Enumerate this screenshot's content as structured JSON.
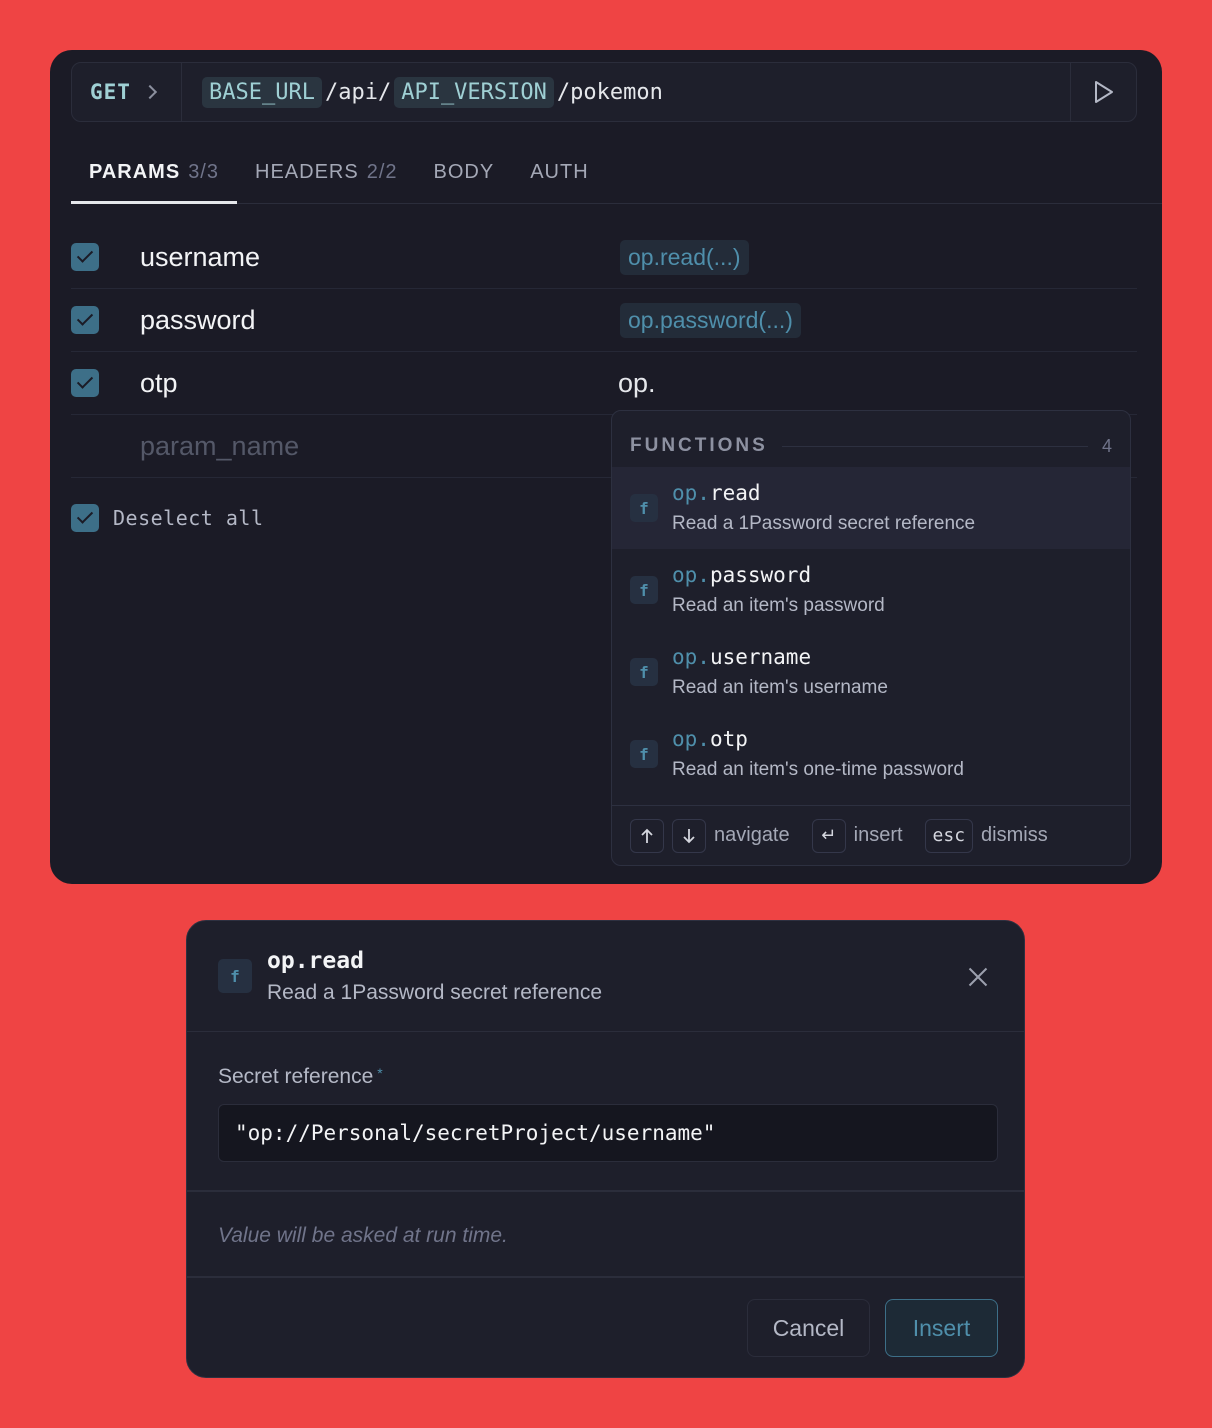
{
  "request": {
    "method": "GET",
    "url": {
      "base_var": "BASE_URL",
      "seg1": "/api/",
      "version_var": "API_VERSION",
      "seg2": "/pokemon"
    }
  },
  "tabs": [
    {
      "label": "PARAMS",
      "count": "3/3"
    },
    {
      "label": "HEADERS",
      "count": "2/2"
    },
    {
      "label": "BODY"
    },
    {
      "label": "AUTH"
    }
  ],
  "params": [
    {
      "name": "username",
      "value": "op.read(...)",
      "checked": true
    },
    {
      "name": "password",
      "value": "op.password(...)",
      "checked": true
    },
    {
      "name": "otp",
      "value": "op.",
      "checked": true
    }
  ],
  "new_param_placeholder": "param_name",
  "deselect_all_label": "Deselect all",
  "autocomplete": {
    "title": "FUNCTIONS",
    "count": "4",
    "items": [
      {
        "ns": "op.",
        "name": "read",
        "desc": "Read a 1Password secret reference",
        "badge": "f"
      },
      {
        "ns": "op.",
        "name": "password",
        "desc": "Read an item's password",
        "badge": "f"
      },
      {
        "ns": "op.",
        "name": "username",
        "desc": "Read an item's username",
        "badge": "f"
      },
      {
        "ns": "op.",
        "name": "otp",
        "desc": "Read an item's one-time password",
        "badge": "f"
      }
    ],
    "footer": {
      "navigate_label": "navigate",
      "insert_key": "↵",
      "insert_label": "insert",
      "esc_key": "esc",
      "dismiss_label": "dismiss"
    }
  },
  "dialog": {
    "badge": "f",
    "name": "op.read",
    "desc": "Read a 1Password secret reference",
    "field_label": "Secret reference",
    "required_mark": "*",
    "field_value": "\"op://Personal/secretProject/username\"",
    "note": "Value will be asked at run time.",
    "cancel_label": "Cancel",
    "insert_label": "Insert"
  },
  "colors": {
    "background": "#ef4444",
    "panel": "#1b1b26",
    "accent": "#4f8fab",
    "var_chip": "#9fd0d4"
  }
}
